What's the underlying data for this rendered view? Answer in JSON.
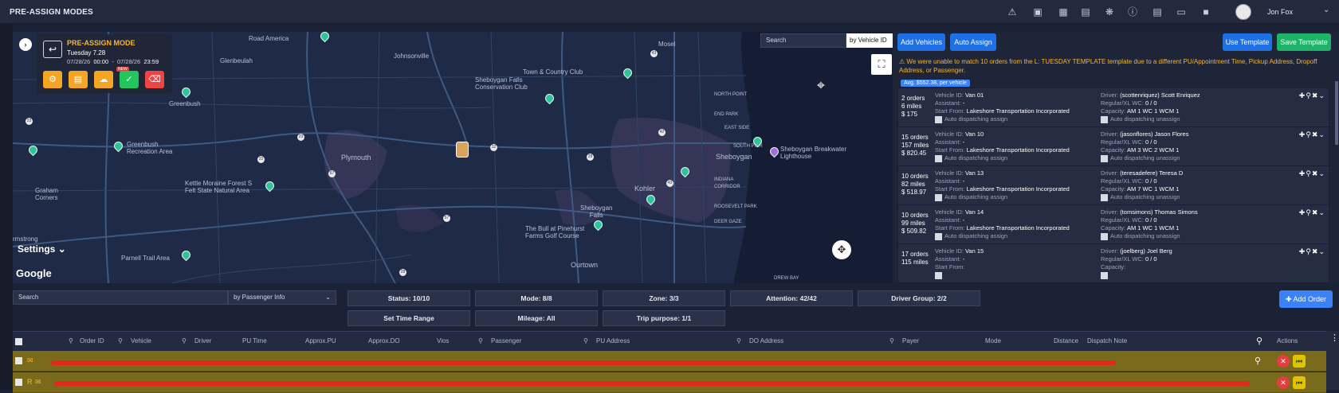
{
  "header": {
    "title": "PRE-ASSIGN MODES",
    "user": "Jon Fox",
    "icons": [
      "bell-icon",
      "box-icon",
      "truck-icon",
      "chat-icon",
      "bug-icon",
      "help-icon",
      "document-icon",
      "cast-icon",
      "camera-icon"
    ]
  },
  "map": {
    "card": {
      "title": "PRE-ASSIGN MODE",
      "date": "Tuesday 7.28",
      "start_date": "07/28/26",
      "start_time": "00:00",
      "sep": "-",
      "end_date": "07/28/26",
      "end_time": "23:59",
      "new_badge": "NEW"
    },
    "search_placeholder": "Search",
    "search_by": "by Vehicle ID",
    "settings_label": "Settings",
    "google_label": "Google",
    "labels": {
      "road_american": "Road America",
      "mosel": "Mosel",
      "glenbeulah": "Glenbeulah",
      "johnsonville": "Johnsonville",
      "town_country": "Town & Country Club",
      "greenbush": "Greenbush",
      "sheboygan_falls_cons": "Sheboygan Falls\nConservation Club",
      "greenbush_rec": "Greenbush\nRecreation Area",
      "plymouth": "Plymouth",
      "sheboygan": "Sheboygan",
      "breakwater": "Sheboygan Breakwater\nLighthouse",
      "kettle": "Kettle Moraine Forest S\nFelt State Natural Area",
      "kohler": "Kohler",
      "sheb_falls": "Sheboygan\nFalls",
      "indiana": "INDIANA\nCORRIDOR",
      "south_pier": "SOUTH PIER",
      "roosevelt": "ROOSEVELT PARK",
      "graham": "Graham\nCorners",
      "pinehurst": "The Bull at Pinehurst\nFarms Golf Course",
      "parnell": "Parnell Trail Area",
      "ourtown": "Ourtown",
      "armstrong": "rmstrong",
      "north_point": "NORTH POINT",
      "end_park": "END PARK",
      "east_side": "EAST SIDE",
      "deer_gaze": "DEER GAZE",
      "drew_bay": "DREW BAY"
    }
  },
  "panel": {
    "add_vehicles": "Add Vehicles",
    "auto_assign": "Auto Assign",
    "use_template": "Use Template",
    "save_template": "Save Template",
    "warning": "We were unable to match 10 orders from the L: TUESDAY TEMPLATE template due to a different PU/Appointment Time, Pickup Address, Dropoff Address, or Passenger.",
    "avg": "Avg. $552.38, per vehicle",
    "vehicles": [
      {
        "orders": "2 orders",
        "miles": "6 miles",
        "amount": "$ 175",
        "vid": "Van 01",
        "driver": "(scottenriquez) Scott Enriquez",
        "assistant": "-",
        "wc": "0 / 0",
        "start": "Lakeshore Transportation Incorporated",
        "capacity": "AM 1 WC 1 WCM 1",
        "auto_assign": "Auto dispatching assign",
        "auto_unassign": "Auto dispatching unassign"
      },
      {
        "orders": "15 orders",
        "miles": "157 miles",
        "amount": "$ 820.45",
        "vid": "Van 10",
        "driver": "(jasonflores) Jason Flores",
        "assistant": "-",
        "wc": "0 / 0",
        "start": "Lakeshore Transportation Incorporated",
        "capacity": "AM 3 WC 2 WCM 1",
        "auto_assign": "Auto dispatching assign",
        "auto_unassign": "Auto dispatching unassign"
      },
      {
        "orders": "10 orders",
        "miles": "82 miles",
        "amount": "$ 518.97",
        "vid": "Van 13",
        "driver": "(teresadefere) Teresa D",
        "assistant": "-",
        "wc": "0 / 0",
        "start": "Lakeshore Transportation Incorporated",
        "capacity": "AM 7 WC 1 WCM 1",
        "auto_assign": "Auto dispatching assign",
        "auto_unassign": "Auto dispatching unassign"
      },
      {
        "orders": "10 orders",
        "miles": "99 miles",
        "amount": "$ 509.82",
        "vid": "Van 14",
        "driver": "(tomsimons) Thomas Simons",
        "assistant": "-",
        "wc": "0 / 0",
        "start": "Lakeshore Transportation Incorporated",
        "capacity": "AM 1 WC 1 WCM 1",
        "auto_assign": "Auto dispatching assign",
        "auto_unassign": "Auto dispatching unassign"
      },
      {
        "orders": "17 orders",
        "miles": "115 miles",
        "amount": "",
        "vid": "Van 15",
        "driver": "(joelberg) Joel Berg",
        "assistant": "-",
        "wc": "0 / 0",
        "start": "",
        "capacity": "",
        "auto_assign": "",
        "auto_unassign": ""
      }
    ],
    "keys": {
      "vid": "Vehicle ID:",
      "driver": "Driver:",
      "assistant": "Assistant:",
      "wc": "Regular/XL WC:",
      "start": "Start From:",
      "capacity": "Capacity:"
    }
  },
  "filters": {
    "search_placeholder": "Search",
    "search_by": "by Passenger Info",
    "status": "Status: 10/10",
    "mode": "Mode: 8/8",
    "zone": "Zone: 3/3",
    "attention": "Attention: 42/42",
    "driver_group": "Driver Group: 2/2",
    "time_range": "Set Time Range",
    "mileage": "Mileage: All",
    "trip_purpose": "Trip purpose: 1/1",
    "add_order": "Add Order"
  },
  "table": {
    "headers": [
      "Order ID",
      "Vehicle",
      "Driver",
      "PU Time",
      "Approx.PU",
      "Approx.DO",
      "Vios",
      "Passenger",
      "PU Address",
      "DO Address",
      "Payer",
      "Mode",
      "Distance",
      "Dispatch Note",
      "Actions"
    ],
    "row2_prefix": "R"
  },
  "colors": {
    "accent": "#3b82f6",
    "green": "#22c55e",
    "warning": "#f5b531",
    "row": "#7a6a1c"
  }
}
